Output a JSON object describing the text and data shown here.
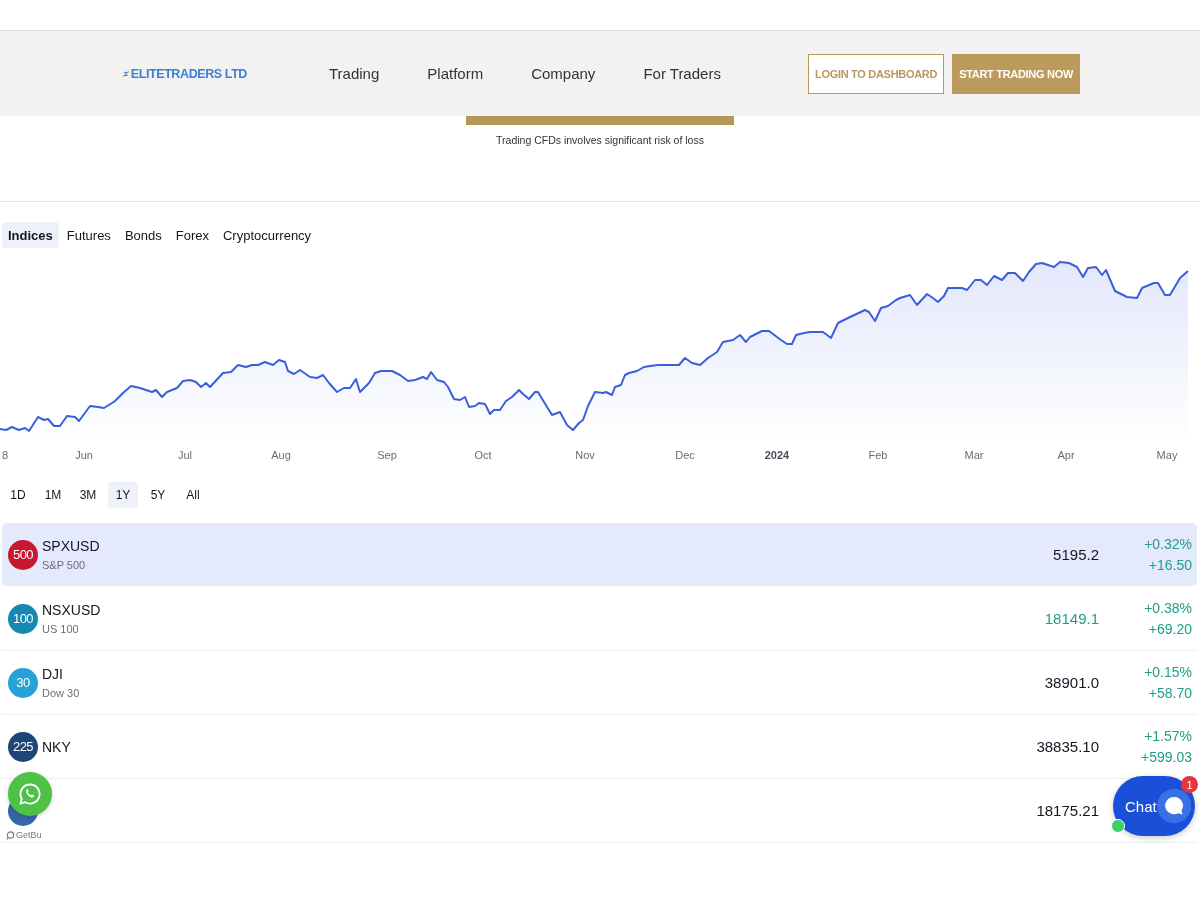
{
  "header": {
    "logo": "ELITETRADERS LTD",
    "nav": [
      "Trading",
      "Platform",
      "Company",
      "For Traders"
    ],
    "login_button": "LOGIN TO DASHBOARD",
    "cta_button": "START TRADING NOW"
  },
  "risk_notice": "Trading CFDs involves significant risk of loss",
  "tabs": [
    {
      "label": "Indices",
      "selected": true
    },
    {
      "label": "Futures",
      "selected": false
    },
    {
      "label": "Bonds",
      "selected": false
    },
    {
      "label": "Forex",
      "selected": false
    },
    {
      "label": "Cryptocurrency",
      "selected": false
    }
  ],
  "chart": {
    "x_labels": [
      {
        "label": "8",
        "kind": "day"
      },
      {
        "label": "Jun",
        "kind": "month"
      },
      {
        "label": "Jul",
        "kind": "month"
      },
      {
        "label": "Aug",
        "kind": "month"
      },
      {
        "label": "Sep",
        "kind": "month"
      },
      {
        "label": "Oct",
        "kind": "month"
      },
      {
        "label": "Nov",
        "kind": "month"
      },
      {
        "label": "Dec",
        "kind": "month"
      },
      {
        "label": "2024",
        "kind": "year"
      },
      {
        "label": "Feb",
        "kind": "month"
      },
      {
        "label": "Mar",
        "kind": "month"
      },
      {
        "label": "Apr",
        "kind": "month"
      },
      {
        "label": "May",
        "kind": "month"
      }
    ]
  },
  "ranges": [
    {
      "label": "1D",
      "selected": false
    },
    {
      "label": "1M",
      "selected": false
    },
    {
      "label": "3M",
      "selected": false
    },
    {
      "label": "1Y",
      "selected": true
    },
    {
      "label": "5Y",
      "selected": false
    },
    {
      "label": "All",
      "selected": false
    }
  ],
  "rows": [
    {
      "badge": "500",
      "color": "#c8182f",
      "symbol": "SPXUSD",
      "name": "S&P 500",
      "price": "5195.2",
      "price_rising": false,
      "change_percent": "+0.32%",
      "change_amount": "+16.50",
      "selected": true
    },
    {
      "badge": "100",
      "color": "#1689b3",
      "symbol": "NSXUSD",
      "name": "US 100",
      "price": "18149.1",
      "price_rising": true,
      "change_percent": "+0.38%",
      "change_amount": "+69.20",
      "selected": false
    },
    {
      "badge": "30",
      "color": "#27a1d7",
      "symbol": "DJI",
      "name": "Dow 30",
      "price": "38901.0",
      "price_rising": false,
      "change_percent": "+0.15%",
      "change_amount": "+58.70",
      "selected": false
    },
    {
      "badge": "225",
      "color": "#1d4576",
      "symbol": "NKY",
      "price": "38835.10",
      "price_rising": false,
      "change_percent": "+1.57%",
      "change_amount": "+599.03",
      "selected": false
    },
    {
      "color": "#3566a6",
      "price": "18175.21",
      "price_rising": false,
      "selected": false
    }
  ],
  "messenger": {
    "caption": "GetBu"
  },
  "chat": {
    "label": "Chat",
    "badge": "1",
    "online": true
  }
}
